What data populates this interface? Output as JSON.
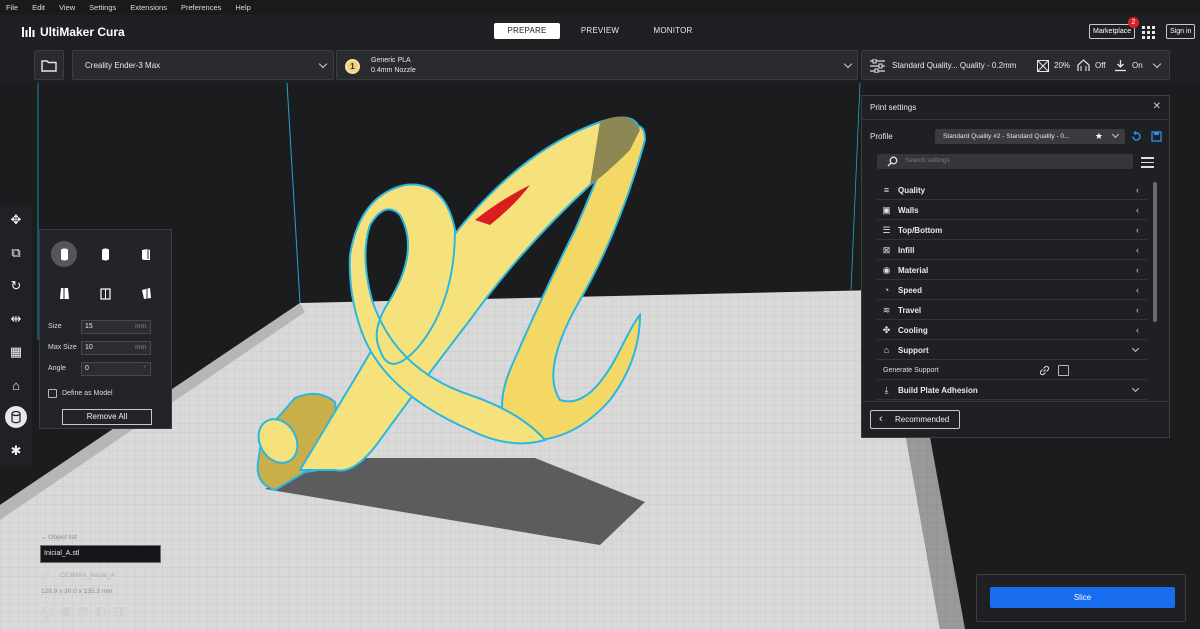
{
  "menu": [
    "File",
    "Edit",
    "View",
    "Settings",
    "Extensions",
    "Preferences",
    "Help"
  ],
  "app": {
    "title": "UltiMaker Cura"
  },
  "stages": [
    {
      "label": "PREPARE",
      "active": true
    },
    {
      "label": "PREVIEW",
      "active": false
    },
    {
      "label": "MONITOR",
      "active": false
    }
  ],
  "header": {
    "marketplace": "Marketplace",
    "marketplace_badge": "2",
    "signin": "Sign in"
  },
  "printer": {
    "name": "Creality Ender-3 Max"
  },
  "material": {
    "name": "Generic PLA",
    "nozzle": "0.4mm Nozzle",
    "extruder": "1",
    "color": "#f3d27a"
  },
  "quality_bar": {
    "profile": "Standard Quality... Quality - 0.2mm",
    "infill": "20%",
    "support": "Off",
    "adhesion": "On"
  },
  "tool_panel": {
    "size_label": "Size",
    "size_value": "15",
    "size_unit": "mm",
    "max_size_label": "Max Size",
    "max_size_value": "10",
    "max_size_unit": "mm",
    "angle_label": "Angle",
    "angle_value": "0",
    "angle_unit": "°",
    "define_as_model": "Define as Model",
    "remove_all": "Remove All"
  },
  "object_list": {
    "header": "Object list",
    "selected": "Inicial_A.stl",
    "job_name": "CE3MAX_Inicial_A",
    "dimensions": "129.9 x 30.0 x 135.3 mm"
  },
  "print_settings": {
    "title": "Print settings",
    "profile_label": "Profile",
    "profile_value": "Standard Quality #2 - Standard Quality - 0...",
    "search_placeholder": "Search settings",
    "categories": [
      {
        "label": "Quality",
        "icon": "quality-icon",
        "expanded": false
      },
      {
        "label": "Walls",
        "icon": "walls-icon",
        "expanded": false
      },
      {
        "label": "Top/Bottom",
        "icon": "top-bottom-icon",
        "expanded": false
      },
      {
        "label": "Infill",
        "icon": "infill-icon",
        "expanded": false
      },
      {
        "label": "Material",
        "icon": "material-icon",
        "expanded": false
      },
      {
        "label": "Speed",
        "icon": "speed-icon",
        "expanded": false
      },
      {
        "label": "Travel",
        "icon": "travel-icon",
        "expanded": false
      },
      {
        "label": "Cooling",
        "icon": "cooling-icon",
        "expanded": false
      },
      {
        "label": "Support",
        "icon": "support-icon",
        "expanded": true
      }
    ],
    "generate_support": "Generate Support",
    "build_plate_adhesion": "Build Plate Adhesion",
    "recommended": "Recommended"
  },
  "slice": {
    "label": "Slice",
    "color": "#196ef0"
  },
  "model_color": "#f6e27c",
  "outline_color": "#2ab7e0"
}
